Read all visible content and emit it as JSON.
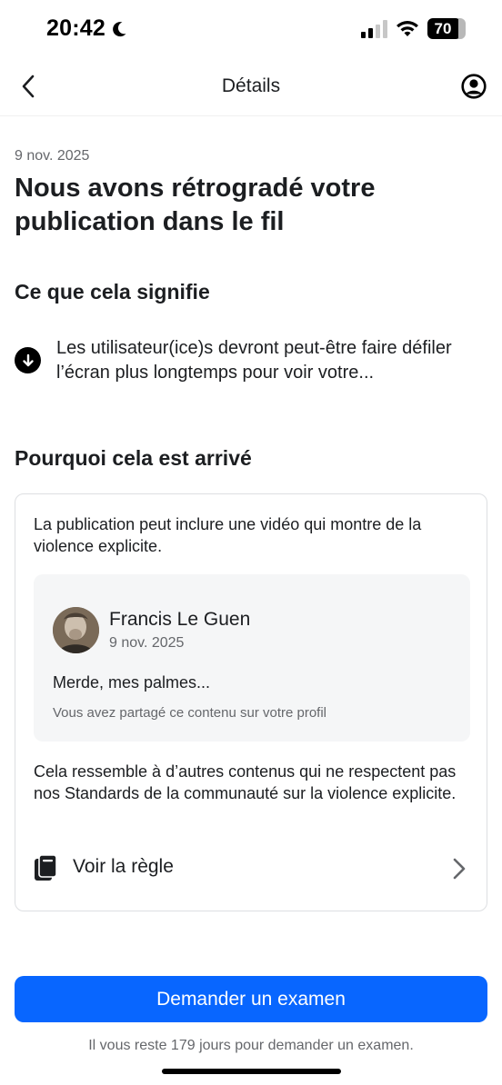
{
  "status_bar": {
    "time": "20:42",
    "battery": "70",
    "icons": [
      "moon-icon",
      "signal-icon",
      "wifi-icon",
      "battery-icon"
    ]
  },
  "nav": {
    "title": "Détails",
    "back_icon": "chevron-left-icon",
    "profile_icon": "account-circle-icon"
  },
  "notice": {
    "date": "9 nov. 2025",
    "headline": "Nous avons rétrogradé votre publication dans le fil"
  },
  "meaning": {
    "title": "Ce que cela signifie",
    "icon": "arrow-down-circle-icon",
    "text": "Les utilisateur(ice)s devront peut-être faire défiler l’écran plus longtemps pour voir votre..."
  },
  "why": {
    "title": "Pourquoi cela est arrivé",
    "description": "La publication peut inclure une vidéo qui montre de la violence explicite.",
    "post": {
      "author": "Francis Le Guen",
      "date": "9 nov. 2025",
      "text": "Merde, mes palmes...",
      "note": "Vous avez partagé ce contenu sur votre profil"
    },
    "similar_text": "Cela ressemble à d’autres contenus qui ne respectent pas nos Standards de la communauté sur la violence explicite.",
    "rule_label": "Voir la règle"
  },
  "actions": {
    "review_button": "Demander un examen",
    "days_left": "Il vous reste 179 jours pour demander un examen."
  },
  "colors": {
    "primary": "#0866ff",
    "text": "#1c1e21",
    "secondary_text": "#65676b",
    "card_border": "#dddfe2",
    "preview_bg": "#f5f6f7"
  }
}
